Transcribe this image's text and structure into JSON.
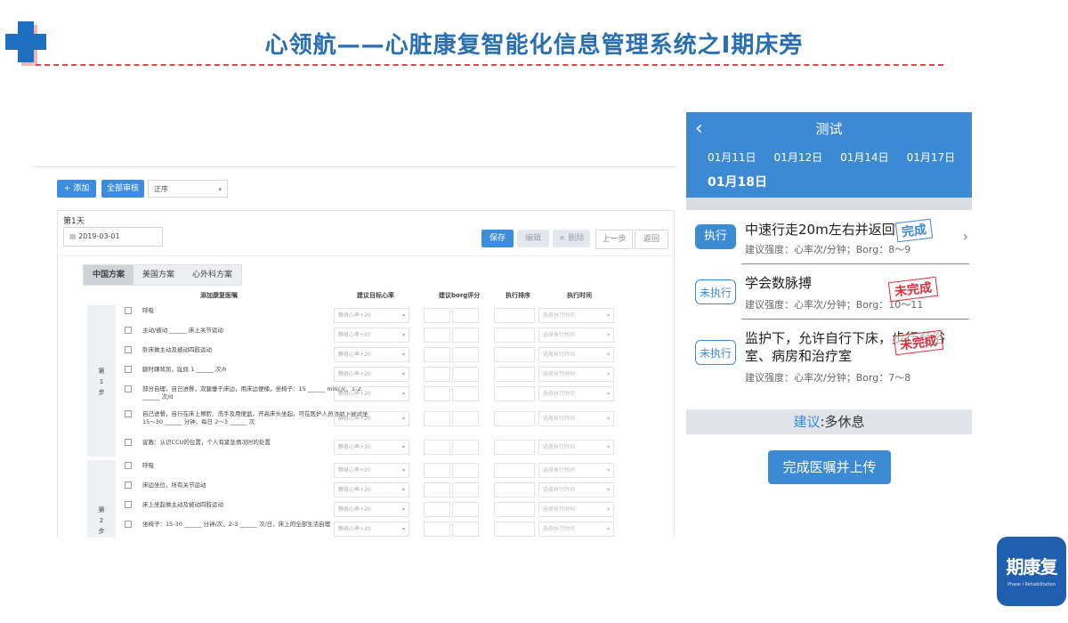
{
  "header": {
    "title": "心领航——心脏康复智能化信息管理系统之Ⅰ期床旁"
  },
  "left": {
    "toolbar": {
      "add": "+ 添加",
      "review_all": "全部审核",
      "sort": "正序"
    },
    "day_label": "第1天",
    "date": "2019-03-01",
    "actions": {
      "save": "保存",
      "edit": "编辑",
      "delete": "× 删除",
      "prev": "上一步",
      "back": "返回"
    },
    "tabs": [
      "中国方案",
      "美国方案",
      "心外科方案"
    ],
    "columns": {
      "item": "添加康复医嘱",
      "hr": "建议目标心率",
      "borg": "建议borg评分",
      "order": "执行排序",
      "time": "执行时间"
    },
    "hr_placeholder": "静息心率+20",
    "time_placeholder": "选择执行时间",
    "steps": [
      {
        "label": "第\n1\n步",
        "rows": [
          "呼吸",
          "主动/被动 ______ 床上关节运动",
          "卧床做主动及被动四肢运动",
          "腿时踝背屈，趾屈 1 ______ 次/h",
          "部分自理，自己进餐，双腿垂于床边，用床边便桶，坐椅子：15 ______ min/次，1-2 ______ 次/d",
          "自己进餐，自行在床上擦脸、洗手及用便盆，开高床头坐起，可在医护人员协助下尝试坐 15～30 ______ 分钟，每日 2～3 ______ 次",
          "宣教：认识CCU的位置，个人有紧急情况时的处置"
        ]
      },
      {
        "label": "第\n2\n步",
        "rows": [
          "呼吸",
          "床边坐位，所有关节运动",
          "床上坐起做主动及被动四肢运动",
          "坐椅子：15-30 ______ 分钟/次，2-3 ______ 次/日，床上的全部生活自理"
        ]
      }
    ]
  },
  "phone": {
    "back": "‹",
    "title": "测试",
    "dates": [
      "01月11日",
      "01月12日",
      "01月14日",
      "01月17日"
    ],
    "selected_date": "01月18日",
    "tasks": [
      {
        "tag": "执行",
        "main": "中速行走20m左右并返回",
        "sub": "建议强度：心率次/分钟；Borg：8～9",
        "stamp": "完成"
      },
      {
        "tag": "未执行",
        "main": "学会数脉搏",
        "sub": "建议强度：心率次/分钟；Borg：10～11",
        "stamp": "未完成"
      },
      {
        "tag": "未执行",
        "main": "监护下，允许自行下床，步行至浴室、病房和治疗室",
        "sub": "建议强度：心率次/分钟；Borg：7～8",
        "stamp": "未完成"
      }
    ],
    "advice_key": "建议",
    "advice_value": ":多休息",
    "done_button": "完成医嘱并上传"
  },
  "logo": {
    "text": "期康复",
    "sub": "Phase I Rehabilitation"
  },
  "colors": {
    "brand_blue": "#3d8ad4",
    "title_blue": "#2a6fb0",
    "stamp_red": "#d9303a"
  }
}
